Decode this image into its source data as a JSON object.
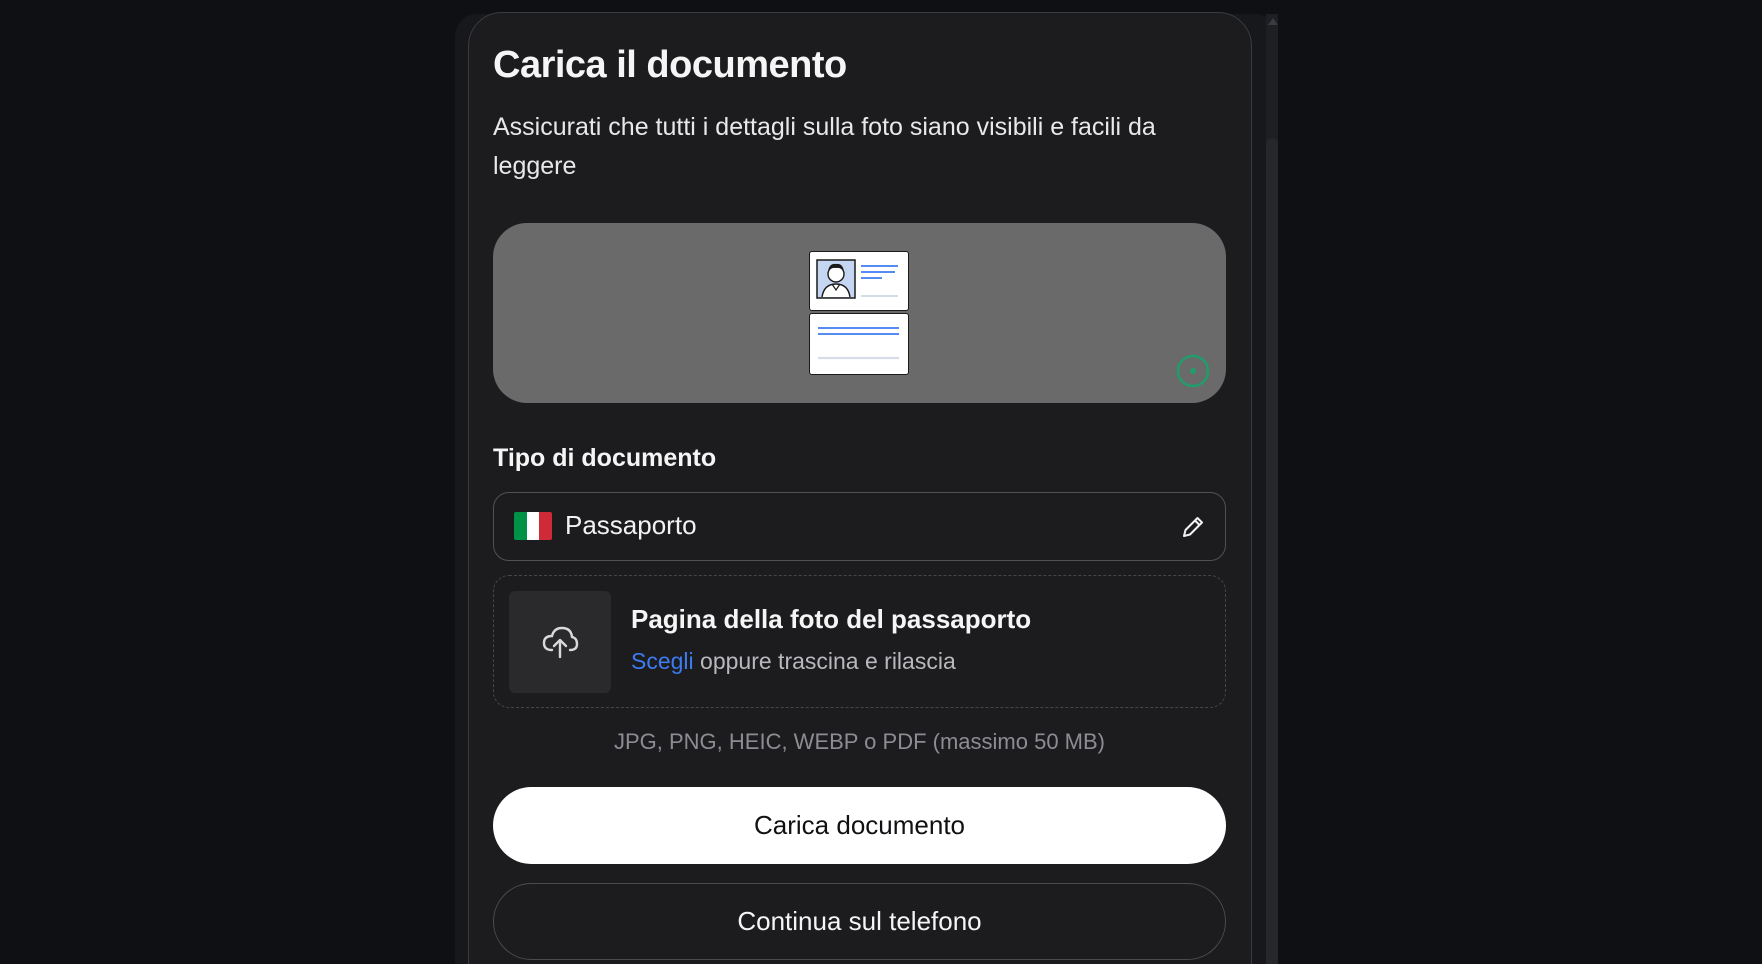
{
  "upload_card": {
    "title": "Carica il documento",
    "subtitle": "Assicurati che tutti i dettagli sulla foto siano visibili e facili da leggere",
    "preview": {
      "illustration": "id-document-illustration",
      "status_icon": "progress-ring-icon",
      "accent_color": "#1f9d6b"
    },
    "document_type": {
      "label": "Tipo di documento",
      "flag": "italy-flag-icon",
      "flag_colors": [
        "#009246",
        "#ffffff",
        "#ce2b37"
      ],
      "value": "Passaporto",
      "edit_icon": "pencil-icon"
    },
    "dropzone": {
      "icon": "cloud-upload-icon",
      "title": "Pagina della foto del passaporto",
      "choose_link": "Scegli",
      "hint": "oppure trascina e rilascia",
      "link_color": "#3d7bf0"
    },
    "formats_note": "JPG, PNG, HEIC, WEBP o PDF (massimo 50 MB)",
    "primary_button": "Carica documento",
    "secondary_button": "Continua sul telefono"
  }
}
